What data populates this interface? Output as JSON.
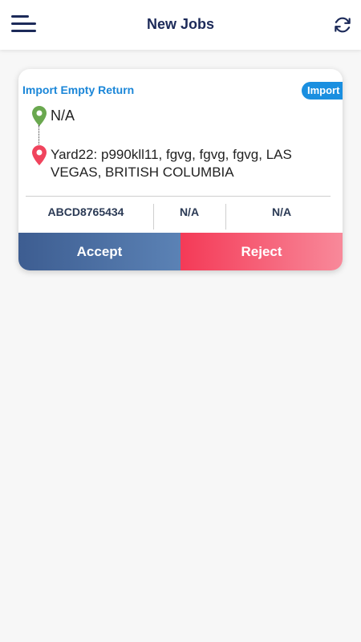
{
  "header": {
    "title": "New Jobs",
    "menu_icon": "hamburger-menu-icon",
    "refresh_icon": "refresh-icon"
  },
  "job": {
    "type": "Import Empty Return",
    "badge": "Import",
    "origin": "N/A",
    "destination": "Yard22: p990kll11, fgvg, fgvg, fgvg, LAS VEGAS, BRITISH COLUMBIA",
    "container_number": "ABCD8765434",
    "field2": "N/A",
    "field3": "N/A",
    "accept_label": "Accept",
    "reject_label": "Reject"
  },
  "colors": {
    "brand_navy": "#1c2a59",
    "job_type_blue": "#1a86d8",
    "origin_pin_green": "#6aa84f",
    "destination_pin_red": "#f0445d",
    "accept_gradient": [
      "#3d5d91",
      "#5b82b5"
    ],
    "reject_gradient": [
      "#f43a57",
      "#f8899a"
    ]
  }
}
